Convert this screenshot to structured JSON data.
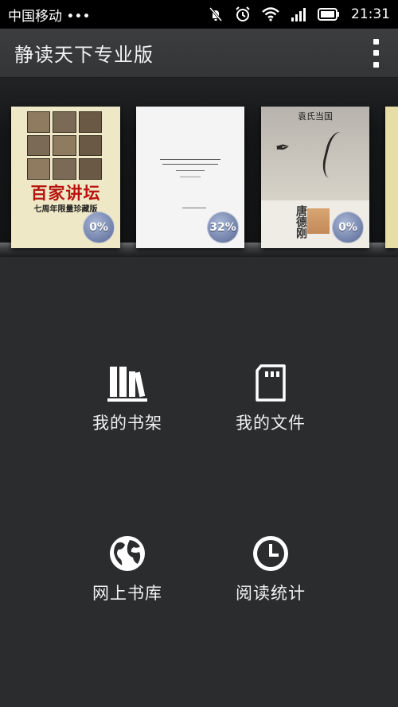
{
  "status_bar": {
    "carrier": "中国移动 •••",
    "time": "21:31"
  },
  "app": {
    "title": "静读天下专业版"
  },
  "bookshelf": [
    {
      "cover_title": "百家讲坛",
      "cover_subtitle": "七周年限量珍藏版",
      "progress": "0%"
    },
    {
      "cover_title": "",
      "progress": "32%"
    },
    {
      "cover_title": "袁氏当国",
      "author": "唐德刚",
      "progress": "0%"
    }
  ],
  "menu": {
    "bookshelf": {
      "label": "我的书架",
      "icon": "books-icon"
    },
    "files": {
      "label": "我的文件",
      "icon": "sd-card-icon"
    },
    "online_library": {
      "label": "网上书库",
      "icon": "globe-icon"
    },
    "reading_stats": {
      "label": "阅读统计",
      "icon": "clock-icon"
    }
  }
}
